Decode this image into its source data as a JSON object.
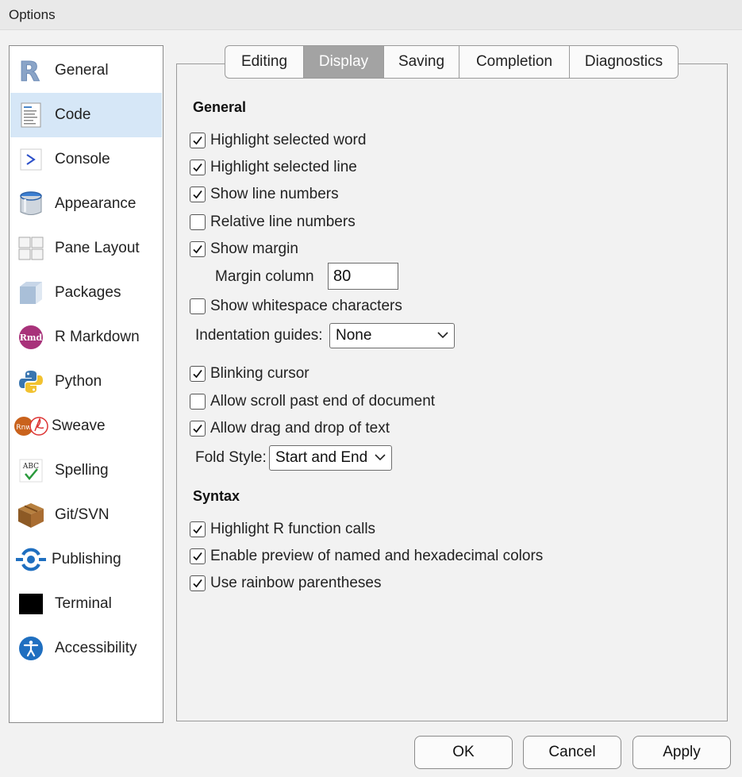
{
  "window": {
    "title": "Options"
  },
  "sidebar": {
    "items": [
      {
        "label": "General",
        "icon": "r-logo-icon"
      },
      {
        "label": "Code",
        "icon": "code-document-icon",
        "selected": true
      },
      {
        "label": "Console",
        "icon": "console-prompt-icon"
      },
      {
        "label": "Appearance",
        "icon": "paint-bucket-icon"
      },
      {
        "label": "Pane Layout",
        "icon": "pane-layout-icon"
      },
      {
        "label": "Packages",
        "icon": "package-box-icon"
      },
      {
        "label": "R Markdown",
        "icon": "rmd-icon"
      },
      {
        "label": "Python",
        "icon": "python-logo-icon"
      },
      {
        "label": "Sweave",
        "icon": "sweave-icon"
      },
      {
        "label": "Spelling",
        "icon": "spelling-abc-icon"
      },
      {
        "label": "Git/SVN",
        "icon": "git-box-icon"
      },
      {
        "label": "Publishing",
        "icon": "publishing-icon"
      },
      {
        "label": "Terminal",
        "icon": "terminal-icon"
      },
      {
        "label": "Accessibility",
        "icon": "accessibility-icon"
      }
    ]
  },
  "tabs": [
    {
      "label": "Editing"
    },
    {
      "label": "Display",
      "active": true
    },
    {
      "label": "Saving"
    },
    {
      "label": "Completion"
    },
    {
      "label": "Diagnostics"
    }
  ],
  "general": {
    "title": "General",
    "options": [
      {
        "label": "Highlight selected word",
        "checked": true
      },
      {
        "label": "Highlight selected line",
        "checked": true
      },
      {
        "label": "Show line numbers",
        "checked": true
      },
      {
        "label": "Relative line numbers",
        "checked": false
      },
      {
        "label": "Show margin",
        "checked": true
      }
    ],
    "margin_column_label": "Margin column",
    "margin_column_value": "80",
    "show_whitespace": {
      "label": "Show whitespace characters",
      "checked": false
    },
    "indentation_guides_label": "Indentation guides:",
    "indentation_guides_value": "None",
    "options2": [
      {
        "label": "Blinking cursor",
        "checked": true
      },
      {
        "label": "Allow scroll past end of document",
        "checked": false
      },
      {
        "label": "Allow drag and drop of text",
        "checked": true
      }
    ],
    "fold_style_label": "Fold Style:",
    "fold_style_value": "Start and End"
  },
  "syntax": {
    "title": "Syntax",
    "options": [
      {
        "label": "Highlight R function calls",
        "checked": true
      },
      {
        "label": "Enable preview of named and hexadecimal colors",
        "checked": true
      },
      {
        "label": "Use rainbow parentheses",
        "checked": true
      }
    ]
  },
  "buttons": {
    "ok": "OK",
    "cancel": "Cancel",
    "apply": "Apply"
  },
  "colors": {
    "selected_bg": "#d6e7f7",
    "active_tab": "#a3a3a3",
    "accent_blue": "#1f6fc0"
  }
}
